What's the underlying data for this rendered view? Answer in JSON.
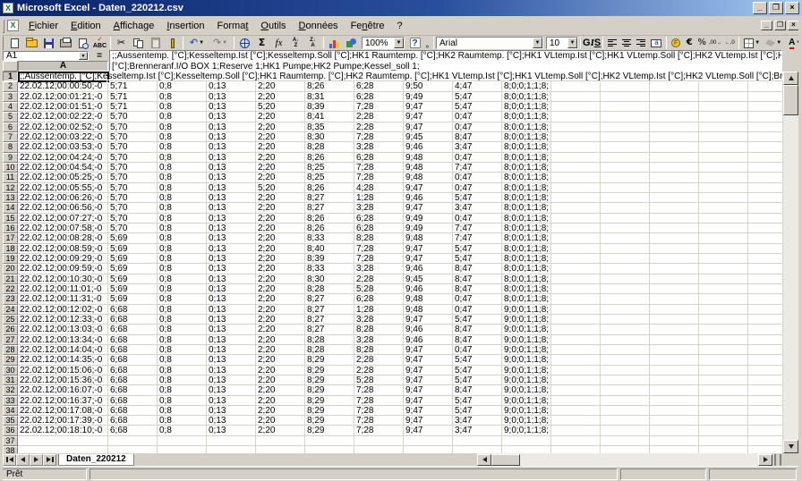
{
  "window": {
    "title": "Microsoft Excel - Daten_220212.csv",
    "min": "_",
    "max": "❐",
    "close": "×"
  },
  "menu": {
    "items": [
      {
        "label": "Fichier",
        "u": 0
      },
      {
        "label": "Edition",
        "u": 0
      },
      {
        "label": "Affichage",
        "u": 0
      },
      {
        "label": "Insertion",
        "u": 0
      },
      {
        "label": "Format",
        "u": 5
      },
      {
        "label": "Outils",
        "u": 0
      },
      {
        "label": "Données",
        "u": 0
      },
      {
        "label": "Fenêtre",
        "u": 2
      },
      {
        "label": "?",
        "u": -1
      }
    ]
  },
  "toolbar": {
    "font_name": "Arial",
    "font_size": "10",
    "zoom": "100%",
    "bold": "G",
    "italic": "I",
    "underline": "S",
    "euro": "€",
    "percent": "%",
    "cut": "✂",
    "undo": "↶",
    "redo": "↷",
    "autosum": "Σ",
    "fx": "fx",
    "sort_az_top": "A",
    "sort_az_bot": "Z",
    "sort_arrow": "↓",
    "spell_top": "ABC",
    "spell_check": "✓",
    "coin": "F",
    "dec_inc": ",00→",
    "dec_dec": "←,0",
    "fontcolor": "A",
    "help": "?",
    "overflow": "»",
    "arrow": "▼"
  },
  "formula_bar": {
    "name_box": "A1",
    "equals": "=",
    "line1": ";;Aussentemp. [°C];Kesseltemp.Ist [°C];Kesseltemp.Soll [°C];HK1 Raumtemp. [°C];HK2 Raumtemp. [°C];HK1 VLtemp.Ist [°C];HK1 VLtemp.Soll [°C];HK2 VLtemp.Ist [°C];HK2 VLtemp.Soll",
    "line2": "[°C];Brenneranf.I/O BOX 1;Reserve 1;HK1 Pumpe;HK2 Pumpe;Kessel_soll 1;"
  },
  "grid": {
    "column_header": "A",
    "row1_text": ";;Aussentemp. [°C];Kesseltemp.Ist [°C];Kesseltemp.Soll [°C];HK1 Raumtemp. [°C];HK2 Raumtemp. [°C];HK1 VLtemp.Ist [°C];HK1 VLtemp.Soll [°C];HK2 VLtemp.Ist [°C];HK2 VLtemp.Soll [°C];Brenneranf.I/O BOX 1;Reserve 1;HK1 Pumpe;HK2 Pumpe;Kessel_soll 1;",
    "rows": [
      {
        "n": 2,
        "cells": [
          "22.02.12;00:00:50;-0",
          "5;71",
          "0;8",
          "0;13",
          "2;20",
          "8;26",
          "6;28",
          "9;50",
          "4;47",
          "8;0;0;1;1;8;"
        ]
      },
      {
        "n": 3,
        "cells": [
          "22.02.12;00:01:21;-0",
          "5;71",
          "0;8",
          "0;13",
          "2;20",
          "8;31",
          "6;28",
          "9;49",
          "5;47",
          "8;0;0;1;1;8;"
        ]
      },
      {
        "n": 4,
        "cells": [
          "22.02.12;00:01:51;-0",
          "5;71",
          "0;8",
          "0;13",
          "5;20",
          "8;39",
          "7;28",
          "9;47",
          "5;47",
          "8;0;0;1;1;8;"
        ]
      },
      {
        "n": 5,
        "cells": [
          "22.02.12;00:02:22;-0",
          "5;70",
          "0;8",
          "0;13",
          "2;20",
          "8;41",
          "2;28",
          "9;47",
          "0;47",
          "8;0;0;1;1;8;"
        ]
      },
      {
        "n": 6,
        "cells": [
          "22.02.12;00:02:52;-0",
          "5;70",
          "0;8",
          "0;13",
          "2;20",
          "8;35",
          "2;28",
          "9;47",
          "0;47",
          "8;0;0;1;1;8;"
        ]
      },
      {
        "n": 7,
        "cells": [
          "22.02.12;00:03:22;-0",
          "5;70",
          "0;8",
          "0;13",
          "2;20",
          "8;30",
          "7;28",
          "9;45",
          "8;47",
          "8;0;0;1;1;8;"
        ]
      },
      {
        "n": 8,
        "cells": [
          "22.02.12;00:03:53;-0",
          "5;70",
          "0;8",
          "0;13",
          "2;20",
          "8;28",
          "3;28",
          "9;46",
          "3;47",
          "8;0;0;1;1;8;"
        ]
      },
      {
        "n": 9,
        "cells": [
          "22.02.12;00:04:24;-0",
          "5;70",
          "0;8",
          "0;13",
          "2;20",
          "8;26",
          "6;28",
          "9;48",
          "0;47",
          "8;0;0;1;1;8;"
        ]
      },
      {
        "n": 10,
        "cells": [
          "22.02.12;00:04:54;-0",
          "5;70",
          "0;8",
          "0;13",
          "2;20",
          "8;25",
          "7;28",
          "9;48",
          "7;47",
          "8;0;0;1;1;8;"
        ]
      },
      {
        "n": 11,
        "cells": [
          "22.02.12;00:05:25;-0",
          "5;70",
          "0;8",
          "0;13",
          "2;20",
          "8;25",
          "7;28",
          "9;48",
          "0;47",
          "8;0;0;1;1;8;"
        ]
      },
      {
        "n": 12,
        "cells": [
          "22.02.12;00:05:55;-0",
          "5;70",
          "0;8",
          "0;13",
          "5;20",
          "8;26",
          "4;28",
          "9;47",
          "0;47",
          "8;0;0;1;1;8;"
        ]
      },
      {
        "n": 13,
        "cells": [
          "22.02.12;00:06:26;-0",
          "5;70",
          "0;8",
          "0;13",
          "2;20",
          "8;27",
          "1;28",
          "9;46",
          "5;47",
          "8;0;0;1;1;8;"
        ]
      },
      {
        "n": 14,
        "cells": [
          "22.02.12;00:06:56;-0",
          "5;70",
          "0;8",
          "0;13",
          "2;20",
          "8;27",
          "3;28",
          "9;47",
          "3;47",
          "8;0;0;1;1;8;"
        ]
      },
      {
        "n": 15,
        "cells": [
          "22.02.12;00:07:27;-0",
          "5;70",
          "0;8",
          "0;13",
          "2;20",
          "8;26",
          "6;28",
          "9;49",
          "0;47",
          "8;0;0;1;1;8;"
        ]
      },
      {
        "n": 16,
        "cells": [
          "22.02.12;00:07:58;-0",
          "5;70",
          "0;8",
          "0;13",
          "2;20",
          "8;26",
          "6;28",
          "9;49",
          "7;47",
          "8;0;0;1;1;8;"
        ]
      },
      {
        "n": 17,
        "cells": [
          "22.02.12;00:08:28;-0",
          "5;69",
          "0;8",
          "0;13",
          "2;20",
          "8;33",
          "8;28",
          "9;48",
          "7;47",
          "8;0;0;1;1;8;"
        ]
      },
      {
        "n": 18,
        "cells": [
          "22.02.12;00:08:59;-0",
          "5;69",
          "0;8",
          "0;13",
          "2;20",
          "8;40",
          "7;28",
          "9;47",
          "5;47",
          "8;0;0;1;1;8;"
        ]
      },
      {
        "n": 19,
        "cells": [
          "22.02.12;00:09:29;-0",
          "5;69",
          "0;8",
          "0;13",
          "2;20",
          "8;39",
          "7;28",
          "9;47",
          "5;47",
          "8;0;0;1;1;8;"
        ]
      },
      {
        "n": 20,
        "cells": [
          "22.02.12;00:09:59;-0",
          "5;69",
          "0;8",
          "0;13",
          "2;20",
          "8;33",
          "3;28",
          "9;46",
          "8;47",
          "8;0;0;1;1;8;"
        ]
      },
      {
        "n": 21,
        "cells": [
          "22.02.12;00:10:30;-0",
          "5;69",
          "0;8",
          "0;13",
          "2;20",
          "8;30",
          "2;28",
          "9;45",
          "8;47",
          "8;0;0;1;1;8;"
        ]
      },
      {
        "n": 22,
        "cells": [
          "22.02.12;00:11:01;-0",
          "5;69",
          "0;8",
          "0;13",
          "2;20",
          "8;28",
          "5;28",
          "9;46",
          "8;47",
          "8;0;0;1;1;8;"
        ]
      },
      {
        "n": 23,
        "cells": [
          "22.02.12;00:11:31;-0",
          "5;69",
          "0;8",
          "0;13",
          "2;20",
          "8;27",
          "6;28",
          "9;48",
          "0;47",
          "8;0;0;1;1;8;"
        ]
      },
      {
        "n": 24,
        "cells": [
          "22.02.12;00:12:02;-0",
          "6;68",
          "0;8",
          "0;13",
          "2;20",
          "8;27",
          "1;28",
          "9;48",
          "0;47",
          "9;0;0;1;1;8;"
        ]
      },
      {
        "n": 25,
        "cells": [
          "22.02.12;00:12:33;-0",
          "6;68",
          "0;8",
          "0;13",
          "2;20",
          "8;27",
          "3;28",
          "9;47",
          "5;47",
          "9;0;0;1;1;8;"
        ]
      },
      {
        "n": 26,
        "cells": [
          "22.02.12;00:13:03;-0",
          "6;68",
          "0;8",
          "0;13",
          "2;20",
          "8;27",
          "8;28",
          "9;46",
          "8;47",
          "9;0;0;1;1;8;"
        ]
      },
      {
        "n": 27,
        "cells": [
          "22.02.12;00:13:34;-0",
          "6;68",
          "0;8",
          "0;13",
          "2;20",
          "8;28",
          "3;28",
          "9;46",
          "8;47",
          "9;0;0;1;1;8;"
        ]
      },
      {
        "n": 28,
        "cells": [
          "22.02.12;00:14:04;-0",
          "6;68",
          "0;8",
          "0;13",
          "2;20",
          "8;28",
          "8;28",
          "9;47",
          "0;47",
          "9;0;0;1;1;8;"
        ]
      },
      {
        "n": 29,
        "cells": [
          "22.02.12;00:14:35;-0",
          "6;68",
          "0;8",
          "0;13",
          "2;20",
          "8;29",
          "2;28",
          "9;47",
          "5;47",
          "9;0;0;1;1;8;"
        ]
      },
      {
        "n": 30,
        "cells": [
          "22.02.12;00:15:06;-0",
          "6;68",
          "0;8",
          "0;13",
          "2;20",
          "8;29",
          "2;28",
          "9;47",
          "5;47",
          "9;0;0;1;1;8;"
        ]
      },
      {
        "n": 31,
        "cells": [
          "22.02.12;00:15:36;-0",
          "6;68",
          "0;8",
          "0;13",
          "2;20",
          "8;29",
          "5;28",
          "9;47",
          "5;47",
          "9;0;0;1;1;8;"
        ]
      },
      {
        "n": 32,
        "cells": [
          "22.02.12;00:16:07;-0",
          "6;68",
          "0;8",
          "0;13",
          "2;20",
          "8;29",
          "7;28",
          "9;47",
          "8;47",
          "9;0;0;1;1;8;"
        ]
      },
      {
        "n": 33,
        "cells": [
          "22.02.12;00:16:37;-0",
          "6;68",
          "0;8",
          "0;13",
          "2;20",
          "8;29",
          "7;28",
          "9;47",
          "5;47",
          "9;0;0;1;1;8;"
        ]
      },
      {
        "n": 34,
        "cells": [
          "22.02.12;00:17:08;-0",
          "6;68",
          "0;8",
          "0;13",
          "2;20",
          "8;29",
          "7;28",
          "9;47",
          "5;47",
          "9;0;0;1;1;8;"
        ]
      },
      {
        "n": 35,
        "cells": [
          "22.02.12;00:17:39;-0",
          "6;68",
          "0;8",
          "0;13",
          "2;20",
          "8;29",
          "7;28",
          "9;47",
          "3;47",
          "9;0;0;1;1;8;"
        ]
      },
      {
        "n": 36,
        "cells": [
          "22.02.12;00:18:10;-0",
          "6;68",
          "0;8",
          "0;13",
          "2;20",
          "8;29",
          "7;28",
          "9;47",
          "3;47",
          "9;0;0;1;1;8;"
        ]
      }
    ]
  },
  "tabs": {
    "sheet": "Daten_220212"
  },
  "status": {
    "ready": "Prêt"
  },
  "colors": {
    "chrome": "#d4d0c8",
    "title_gradient_start": "#0a246a",
    "title_gradient_end": "#a6caf0",
    "gridline": "#d4d4ca",
    "save_icon_blue": "#35359a",
    "fill_yellow": "#ffe000",
    "fontcolor_red": "#d00000"
  }
}
